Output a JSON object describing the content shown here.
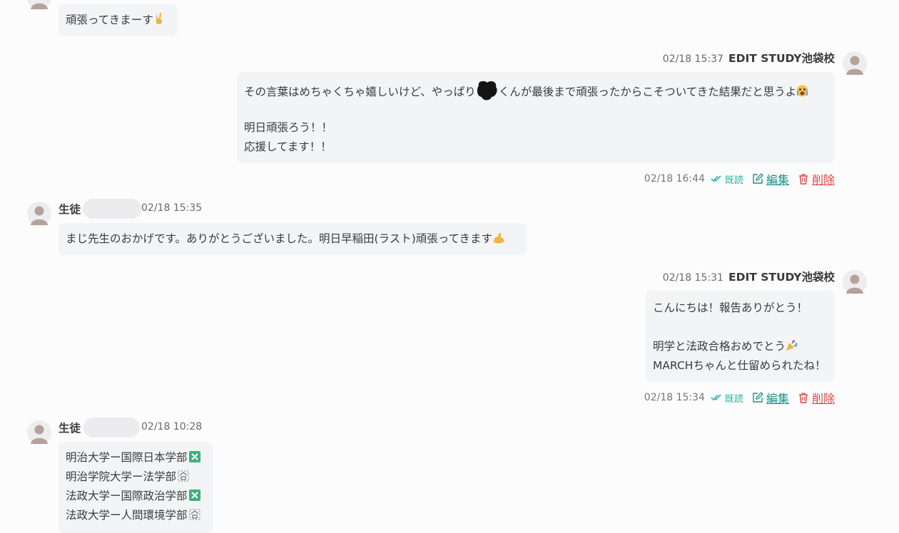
{
  "colors": {
    "background": "#fcfcfc",
    "bubble": "#f3f4f6",
    "read": "#2bb3a3",
    "edit": "#1f8f8a",
    "delete": "#e0453d"
  },
  "messages": [
    {
      "side": "left",
      "lines": [
        "頑張ってきまーす"
      ],
      "emoji": "victory-hand"
    },
    {
      "side": "right",
      "time": "02/18 15:37",
      "sender": "EDIT STUDY池袋校",
      "line1_a": "その言葉はめちゃくちゃ嬉しいけど、やっぱり",
      "line1_b": "くんが最後まで頑張ったからこそついてきた結果だと思うよ",
      "line3": "明日頑張ろう！！",
      "line4": "応援してます！！",
      "footer": {
        "time": "02/18 16:44",
        "read": "既読",
        "edit": "編集",
        "delete": "削除"
      }
    },
    {
      "side": "left",
      "label": "生徒",
      "time": "02/18 15:35",
      "text": "まじ先生のおかげです。ありがとうございました。明日早稲田(ラスト)頑張ってきます"
    },
    {
      "side": "right",
      "time": "02/18 15:31",
      "sender": "EDIT STUDY池袋校",
      "line1": "こんにちは！報告ありがとう！",
      "line3": "明学と法政合格おめでとう",
      "line4": "MARCHちゃんと仕留められたね！",
      "footer": {
        "time": "02/18 15:34",
        "read": "既読",
        "edit": "編集",
        "delete": "削除"
      }
    },
    {
      "side": "left",
      "label": "生徒",
      "time": "02/18 10:28",
      "lines": [
        "明治大学ー国際日本学部",
        "明治学院大学ー法学部",
        "法政大学ー国際政治学部",
        "法政大学ー人間環境学部"
      ]
    }
  ]
}
